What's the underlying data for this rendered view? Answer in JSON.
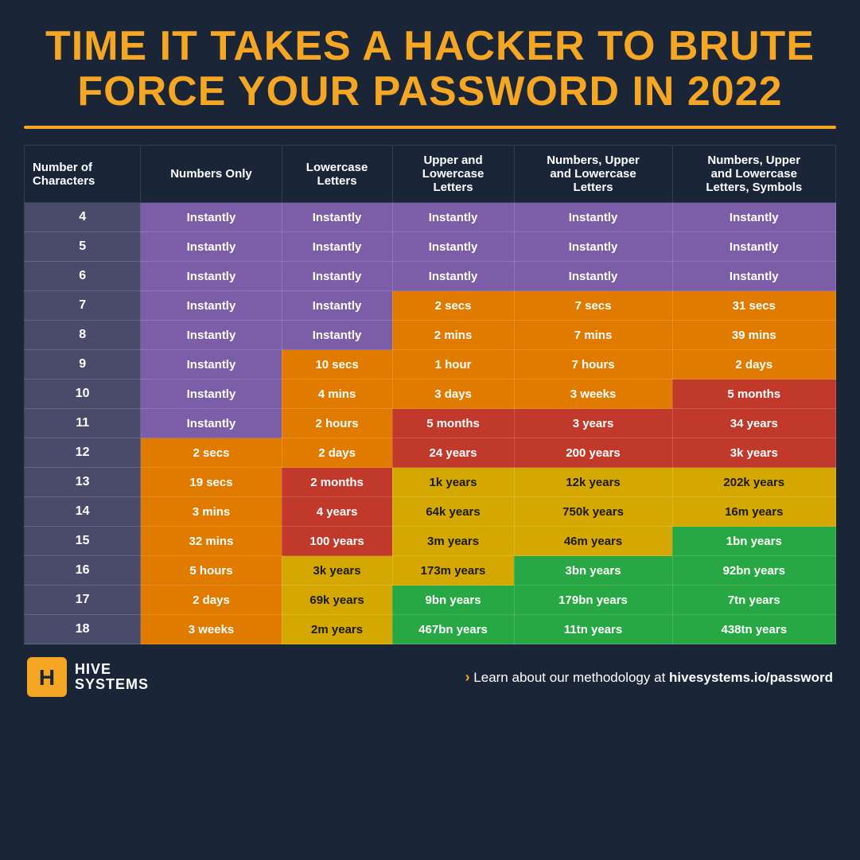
{
  "title": {
    "line1": "TIME IT TAKES A HACKER TO BRUTE",
    "line2": "FORCE YOUR PASSWORD IN ",
    "year": "2022"
  },
  "headers": [
    "Number of\nCharacters",
    "Numbers Only",
    "Lowercase\nLetters",
    "Upper and\nLowercase\nLetters",
    "Numbers, Upper\nand Lowercase\nLetters",
    "Numbers, Upper\nand Lowercase\nLetters, Symbols"
  ],
  "rows": [
    {
      "chars": "4",
      "c1": "Instantly",
      "c2": "Instantly",
      "c3": "Instantly",
      "c4": "Instantly",
      "c5": "Instantly",
      "s1": "c-instantly",
      "s2": "c-instantly",
      "s3": "c-instantly",
      "s4": "c-instantly",
      "s5": "c-instantly"
    },
    {
      "chars": "5",
      "c1": "Instantly",
      "c2": "Instantly",
      "c3": "Instantly",
      "c4": "Instantly",
      "c5": "Instantly",
      "s1": "c-instantly",
      "s2": "c-instantly",
      "s3": "c-instantly",
      "s4": "c-instantly",
      "s5": "c-instantly"
    },
    {
      "chars": "6",
      "c1": "Instantly",
      "c2": "Instantly",
      "c3": "Instantly",
      "c4": "Instantly",
      "c5": "Instantly",
      "s1": "c-instantly",
      "s2": "c-instantly",
      "s3": "c-instantly",
      "s4": "c-instantly",
      "s5": "c-instantly"
    },
    {
      "chars": "7",
      "c1": "Instantly",
      "c2": "Instantly",
      "c3": "2 secs",
      "c4": "7 secs",
      "c5": "31 secs",
      "s1": "c-instantly",
      "s2": "c-instantly",
      "s3": "c-secs-low",
      "s4": "c-secs-low",
      "s5": "c-secs-low"
    },
    {
      "chars": "8",
      "c1": "Instantly",
      "c2": "Instantly",
      "c3": "2 mins",
      "c4": "7 mins",
      "c5": "39 mins",
      "s1": "c-instantly",
      "s2": "c-instantly",
      "s3": "c-mins",
      "s4": "c-mins",
      "s5": "c-mins"
    },
    {
      "chars": "9",
      "c1": "Instantly",
      "c2": "10 secs",
      "c3": "1 hour",
      "c4": "7 hours",
      "c5": "2 days",
      "s1": "c-instantly",
      "s2": "c-secs-low",
      "s3": "c-hours",
      "s4": "c-hours",
      "s5": "c-days"
    },
    {
      "chars": "10",
      "c1": "Instantly",
      "c2": "4 mins",
      "c3": "3 days",
      "c4": "3 weeks",
      "c5": "5 months",
      "s1": "c-instantly",
      "s2": "c-mins",
      "s3": "c-days",
      "s4": "c-weeks",
      "s5": "c-months"
    },
    {
      "chars": "11",
      "c1": "Instantly",
      "c2": "2 hours",
      "c3": "5 months",
      "c4": "3 years",
      "c5": "34 years",
      "s1": "c-instantly",
      "s2": "c-hours",
      "s3": "c-months",
      "s4": "c-years-low",
      "s5": "c-years-low"
    },
    {
      "chars": "12",
      "c1": "2 secs",
      "c2": "2 days",
      "c3": "24 years",
      "c4": "200 years",
      "c5": "3k years",
      "s1": "c-secs-low",
      "s2": "c-days",
      "s3": "c-years-low",
      "s4": "c-years-low",
      "s5": "c-years-low"
    },
    {
      "chars": "13",
      "c1": "19 secs",
      "c2": "2 months",
      "c3": "1k years",
      "c4": "12k years",
      "c5": "202k years",
      "s1": "c-secs-low",
      "s2": "c-months",
      "s3": "c-yellow",
      "s4": "c-yellow",
      "s5": "c-yellow"
    },
    {
      "chars": "14",
      "c1": "3 mins",
      "c2": "4 years",
      "c3": "64k years",
      "c4": "750k years",
      "c5": "16m years",
      "s1": "c-mins",
      "s2": "c-years-low",
      "s3": "c-yellow",
      "s4": "c-yellow",
      "s5": "c-yellow"
    },
    {
      "chars": "15",
      "c1": "32 mins",
      "c2": "100 years",
      "c3": "3m years",
      "c4": "46m years",
      "c5": "1bn years",
      "s1": "c-mins",
      "s2": "c-years-low",
      "s3": "c-yellow",
      "s4": "c-yellow",
      "s5": "c-green"
    },
    {
      "chars": "16",
      "c1": "5 hours",
      "c2": "3k years",
      "c3": "173m years",
      "c4": "3bn years",
      "c5": "92bn years",
      "s1": "c-hours",
      "s2": "c-yellow",
      "s3": "c-yellow",
      "s4": "c-green",
      "s5": "c-green"
    },
    {
      "chars": "17",
      "c1": "2 days",
      "c2": "69k years",
      "c3": "9bn years",
      "c4": "179bn years",
      "c5": "7tn years",
      "s1": "c-days",
      "s2": "c-yellow",
      "s3": "c-green",
      "s4": "c-green",
      "s5": "c-green"
    },
    {
      "chars": "18",
      "c1": "3 weeks",
      "c2": "2m years",
      "c3": "467bn years",
      "c4": "11tn years",
      "c5": "438tn years",
      "s1": "c-weeks",
      "s2": "c-yellow",
      "s3": "c-green",
      "s4": "c-green",
      "s5": "c-green"
    }
  ],
  "footer": {
    "logo_line1": "HIVE",
    "logo_line2": "SYSTEMS",
    "link_text": " Learn about our methodology at ",
    "link_url": "hivesystems.io/password"
  }
}
